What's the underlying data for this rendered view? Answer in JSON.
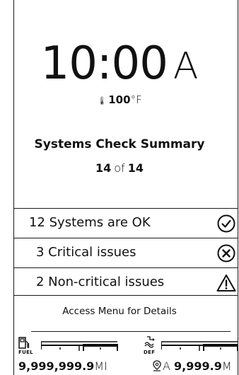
{
  "clock": {
    "time": "10:00",
    "ampm": "A"
  },
  "temperature": {
    "icon": "thermometer-icon",
    "value": "100",
    "unit": "°F"
  },
  "summary": {
    "title": "Systems Check Summary",
    "current": "14",
    "of_label": "of",
    "total": "14"
  },
  "systems": [
    {
      "label": "12 Systems are OK",
      "icon": "check-circle-icon"
    },
    {
      "label": "3 Critical issues",
      "icon": "x-circle-icon"
    },
    {
      "label": "2 Non-critical issues",
      "icon": "warning-triangle-icon"
    }
  ],
  "footer": {
    "text": "Access Menu for Details"
  },
  "fuel_gauge": {
    "label": "FUEL",
    "icon": "fuel-pump-icon"
  },
  "def_gauge": {
    "label": "DEF",
    "icon": "def-fluid-icon"
  },
  "odometer": {
    "value": "9,999,999.9",
    "unit": "MI"
  },
  "trip": {
    "icon": "map-pin-icon",
    "label": "A",
    "value": "9,999.9",
    "unit": "M"
  },
  "colors": {
    "foreground": "#111111",
    "background": "#ffffff"
  }
}
